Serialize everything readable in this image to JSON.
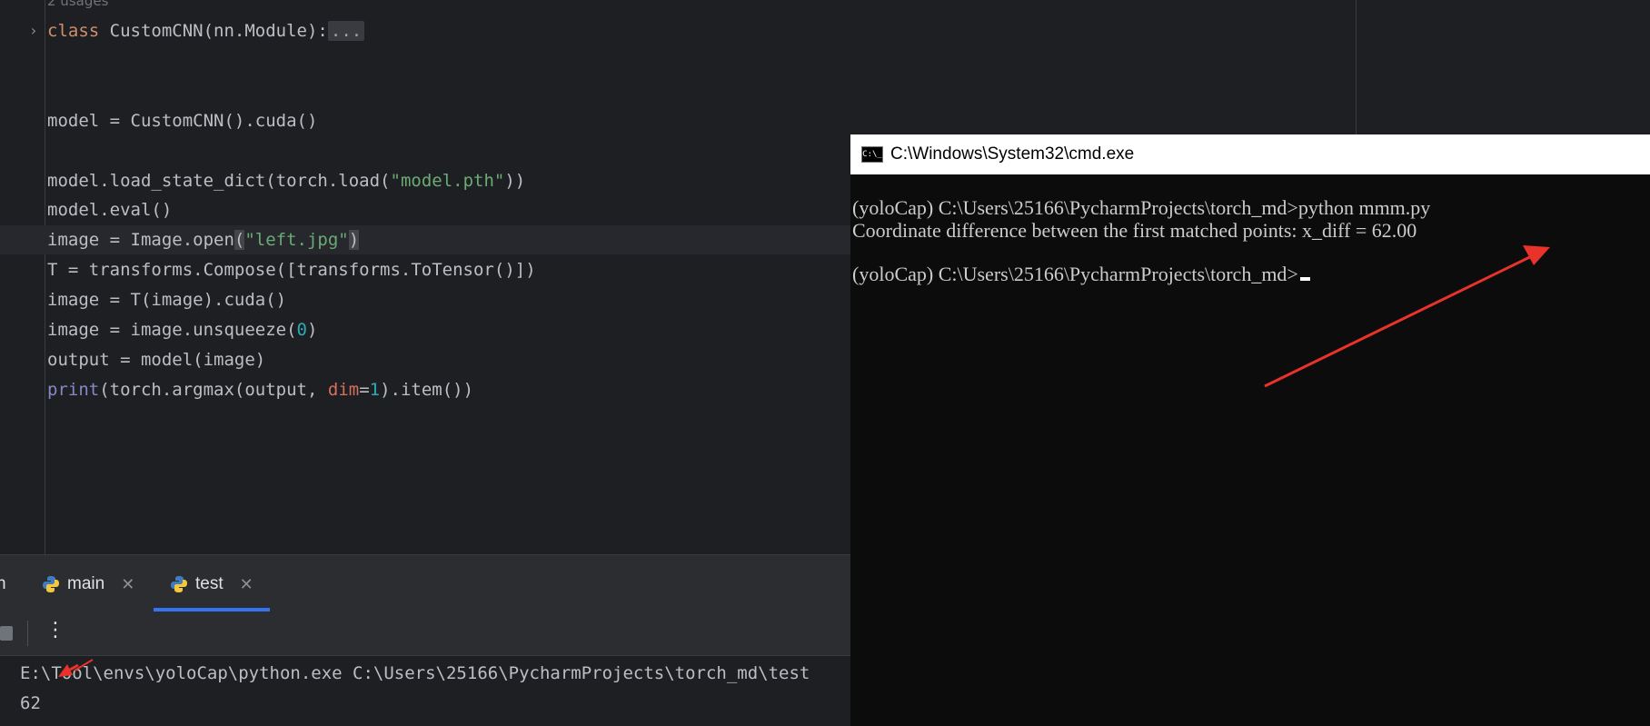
{
  "editor": {
    "usages_hint": "2 usages",
    "fold_dots": "...",
    "lines": {
      "l1": {
        "kw": "class",
        "rest": " CustomCNN(nn.Module):"
      },
      "l2": "model = CustomCNN().cuda()",
      "l3": {
        "a": "model.load_state_dict(torch.load(",
        "s": "\"model.pth\"",
        "b": "))"
      },
      "l4": "model.eval()",
      "l5": {
        "a": "image = Image.open",
        "p1": "(",
        "s": "\"left.jpg\"",
        "p2": ")"
      },
      "l6": "T = transforms.Compose([transforms.ToTensor()])",
      "l7": "image = T(image).cuda()",
      "l8": {
        "a": "image = image.unsqueeze(",
        "n": "0",
        "b": ")"
      },
      "l9": "output = model(image)",
      "l10": {
        "fn": "print",
        "a": "(torch.argmax(output, ",
        "param": "dim",
        "eq": "=",
        "n": "1",
        "b": ").item()",
        "last": ")"
      }
    }
  },
  "tool_window": {
    "partial_tab": "n",
    "tabs": [
      {
        "label": "main",
        "active": false
      },
      {
        "label": "test",
        "active": true
      }
    ],
    "console_lines": [
      "E:\\Tool\\envs\\yoloCap\\python.exe C:\\Users\\25166\\PycharmProjects\\torch_md\\test",
      "62"
    ]
  },
  "cmd": {
    "title": "C:\\Windows\\System32\\cmd.exe",
    "icon_text": "C:\\_",
    "lines": [
      "(yoloCap) C:\\Users\\25166\\PycharmProjects\\torch_md>python mmm.py",
      "Coordinate difference between the first matched points: x_diff = 62.00",
      "(yoloCap) C:\\Users\\25166\\PycharmProjects\\torch_md>"
    ]
  },
  "annotation_color": "#e8322a"
}
